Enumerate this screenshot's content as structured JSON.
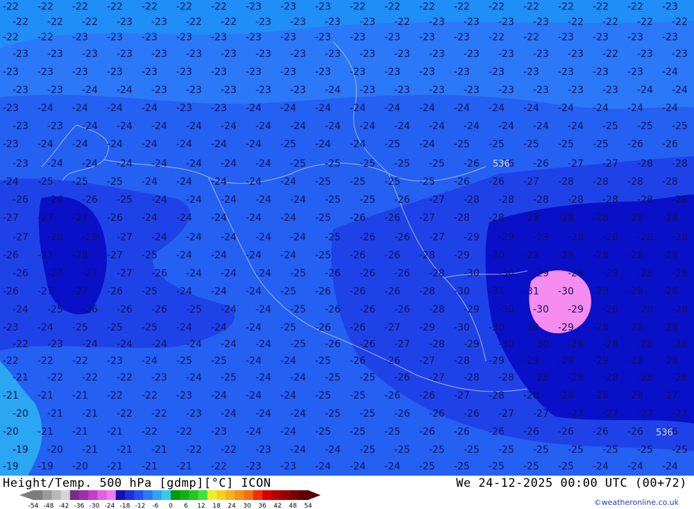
{
  "map": {
    "title": "Height/Temp. 500 hPa [gdmp][°C] ICON",
    "valid_time": "We 24-12-2025 00:00 UTC (00+72)",
    "credit": "©weatheronline.co.uk",
    "height_labels": [
      "536",
      "536"
    ],
    "contour_levels": [
      "-19",
      "-20",
      "-21",
      "-22",
      "-23",
      "-24",
      "-25",
      "-26",
      "-27",
      "-28",
      "-29",
      "-30",
      "-31"
    ],
    "zones": [
      {
        "name": "zone-20",
        "value": "-20",
        "color": "#2aa6f2"
      },
      {
        "name": "zone-22",
        "value": "-22",
        "color": "#1f8ef7"
      },
      {
        "name": "zone-23",
        "value": "-23",
        "color": "#2b78f8"
      },
      {
        "name": "zone-24",
        "value": "-24",
        "color": "#2460f2"
      },
      {
        "name": "zone-26",
        "value": "-26",
        "color": "#1f42e8"
      },
      {
        "name": "zone-28",
        "value": "-28",
        "color": "#0a10c8"
      },
      {
        "name": "zone-30",
        "value": "-30",
        "color": "#f58cf0"
      }
    ]
  },
  "legend": {
    "ticks": [
      "-54",
      "-48",
      "-42",
      "-36",
      "-30",
      "-24",
      "-18",
      "-12",
      "-6",
      "0",
      "6",
      "12",
      "18",
      "24",
      "30",
      "36",
      "42",
      "48",
      "54"
    ],
    "colors": [
      "#7c7c7c",
      "#9a9a9a",
      "#b8b8b8",
      "#d4d4d4",
      "#7a2a8a",
      "#9a30a8",
      "#c040c8",
      "#e060e0",
      "#f078f0",
      "#1010b0",
      "#1a30d8",
      "#2450f0",
      "#2c78f8",
      "#30a0f8",
      "#38c8f0",
      "#089808",
      "#10b010",
      "#20c820",
      "#40e040",
      "#f0f020",
      "#f8d020",
      "#f8b020",
      "#f89010",
      "#f07010",
      "#f03000",
      "#d80000",
      "#b80000",
      "#980000",
      "#780000",
      "#580000"
    ]
  }
}
